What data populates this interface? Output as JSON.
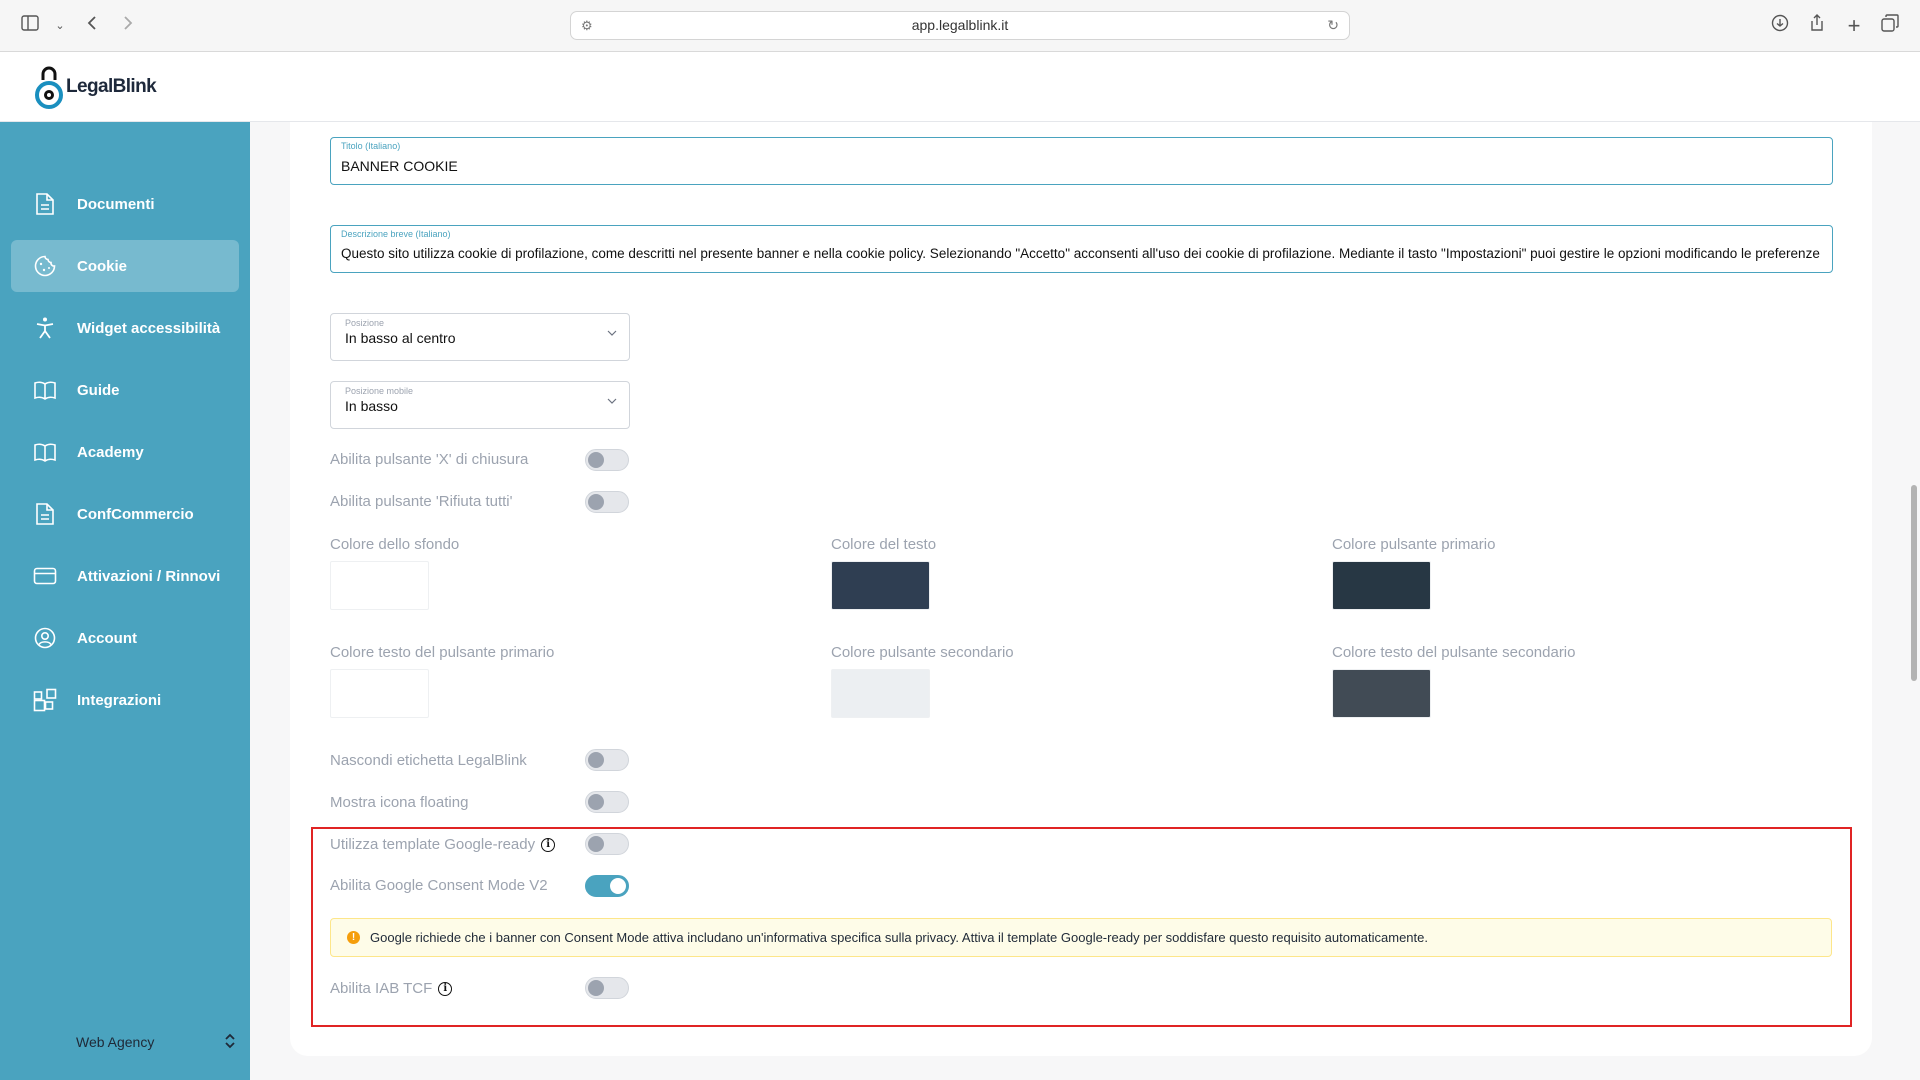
{
  "browser": {
    "url": "app.legalblink.it",
    "icons": [
      "sidebar-toggle-icon",
      "chevron-down-icon",
      "back-icon",
      "forward-icon",
      "site-settings-icon",
      "reload-icon",
      "download-icon",
      "share-icon",
      "new-tab-icon",
      "tabs-overview-icon"
    ]
  },
  "app": {
    "logo_text": "LegalBlink",
    "accent_color": "#4aa3bf"
  },
  "sidebar": {
    "items": [
      {
        "label": "Documenti",
        "icon": "document-icon",
        "active": false
      },
      {
        "label": "Cookie",
        "icon": "cookie-icon",
        "active": true
      },
      {
        "label": "Widget accessibilità",
        "icon": "accessibility-icon",
        "active": false
      },
      {
        "label": "Guide",
        "icon": "book-icon",
        "active": false
      },
      {
        "label": "Academy",
        "icon": "book-icon",
        "active": false
      },
      {
        "label": "ConfCommercio",
        "icon": "document-icon",
        "active": false
      },
      {
        "label": "Attivazioni / Rinnovi",
        "icon": "card-icon",
        "active": false
      },
      {
        "label": "Account",
        "icon": "user-icon",
        "active": false
      },
      {
        "label": "Integrazioni",
        "icon": "integrations-icon",
        "active": false
      }
    ],
    "footer": {
      "label": "Web Agency",
      "icon": "chevron-updown-icon"
    }
  },
  "form": {
    "title_field": {
      "label": "Titolo (Italiano)",
      "value": "BANNER COOKIE"
    },
    "description_field": {
      "label": "Descrizione breve (Italiano)",
      "value": "Questo sito utilizza cookie di profilazione, come descritti nel presente banner e nella cookie policy. Selezionando \"Accetto\" acconsenti all'uso dei cookie di profilazione. Mediante il tasto \"Impostazioni\" puoi gestire le opzioni modificando le preferenze"
    },
    "position": {
      "label": "Posizione",
      "value": "In basso al centro"
    },
    "mobile_position": {
      "label": "Posizione mobile",
      "value": "In basso"
    },
    "toggles_top": [
      {
        "label": "Abilita pulsante 'X' di chiusura",
        "on": false
      },
      {
        "label": "Abilita pulsante 'Rifiuta tutti'",
        "on": false
      }
    ],
    "colors": [
      {
        "label": "Colore dello sfondo",
        "color": "#ffffff"
      },
      {
        "label": "Colore del testo",
        "color": "#2f3e52"
      },
      {
        "label": "Colore pulsante primario",
        "color": "#273744"
      },
      {
        "label": "Colore testo del pulsante primario",
        "color": "#ffffff"
      },
      {
        "label": "Colore pulsante secondario",
        "color": "#eceff2"
      },
      {
        "label": "Colore testo del pulsante secondario",
        "color": "#414b55"
      }
    ],
    "toggles_mid": [
      {
        "label": "Nascondi etichetta LegalBlink",
        "on": false
      },
      {
        "label": "Mostra icona floating",
        "on": false
      }
    ],
    "google_ready": {
      "label": "Utilizza template Google-ready",
      "on": false,
      "info_icon": "info-icon"
    },
    "consent_mode": {
      "label": "Abilita Google Consent Mode V2",
      "on": true
    },
    "alert": {
      "text": "Google richiede che i banner con Consent Mode attiva includano un'informativa specifica sulla privacy. Attiva il template Google-ready per soddisfare questo requisito automaticamente.",
      "icon": "warning-icon",
      "icon_glyph": "!"
    },
    "iab_tcf": {
      "label": "Abilita IAB TCF",
      "on": false,
      "info_icon": "info-icon"
    }
  }
}
